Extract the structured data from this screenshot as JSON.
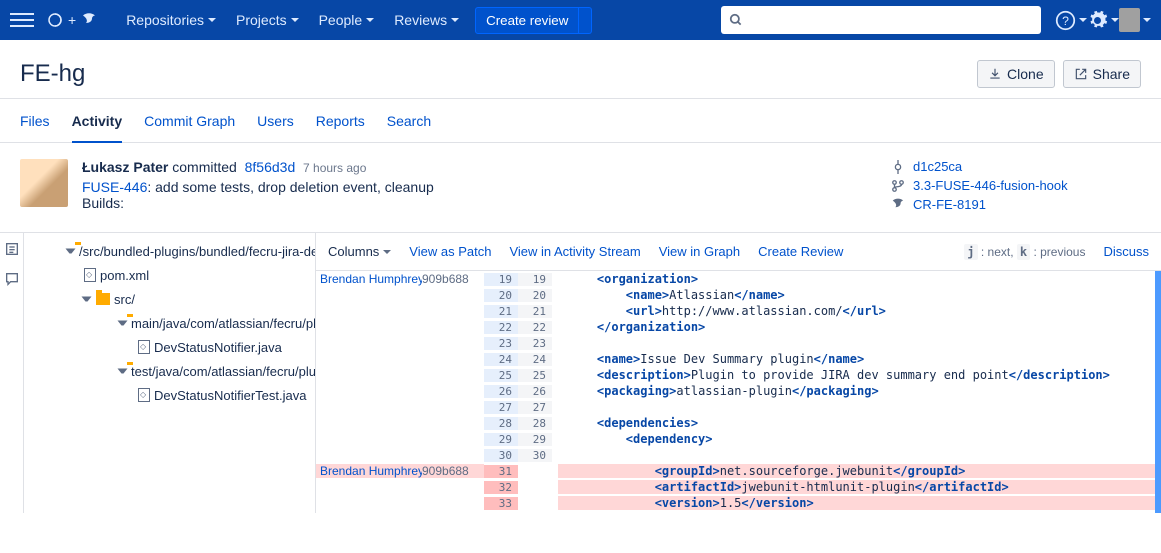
{
  "nav": {
    "items": [
      "Repositories",
      "Projects",
      "People",
      "Reviews"
    ],
    "create": "Create review",
    "search_placeholder": ""
  },
  "header": {
    "title": "FE-hg",
    "clone": "Clone",
    "share": "Share"
  },
  "tabs": [
    "Files",
    "Activity",
    "Commit Graph",
    "Users",
    "Reports",
    "Search"
  ],
  "active_tab": "Activity",
  "commit": {
    "author": "Łukasz Pater",
    "verb": "committed",
    "hash": "8f56d3d",
    "time": "7 hours ago",
    "issue": "FUSE-446",
    "issue_rest": ": add some tests, drop deletion event, cleanup",
    "builds": "Builds:",
    "meta": {
      "parent": "d1c25ca",
      "branch": "3.3-FUSE-446-fusion-hook",
      "review": "CR-FE-8191"
    }
  },
  "tree": {
    "root": "/src/bundled-plugins/bundled/fecru-jira-de",
    "pom": "pom.xml",
    "src": "src/",
    "main": "main/java/com/atlassian/fecru/plug",
    "f1": "DevStatusNotifier.java",
    "test": "test/java/com/atlassian/fecru/plugin",
    "f2": "DevStatusNotifierTest.java"
  },
  "difftb": {
    "columns": "Columns",
    "patch": "View as Patch",
    "stream": "View in Activity Stream",
    "graph": "View in Graph",
    "create": "Create Review",
    "hint_j": "j",
    "hint_next": " : next, ",
    "hint_k": "k",
    "hint_prev": " : previous",
    "discuss": "Discuss"
  },
  "diff": {
    "blame": "Brendan Humphreys",
    "bhash": "909b688",
    "lines": [
      {
        "a": 19,
        "b": 19,
        "html": "    <span class='tag'>&lt;organization&gt;</span>"
      },
      {
        "a": 20,
        "b": 20,
        "html": "        <span class='tag'>&lt;name&gt;</span>Atlassian<span class='tag'>&lt;/name&gt;</span>"
      },
      {
        "a": 21,
        "b": 21,
        "html": "        <span class='tag'>&lt;url&gt;</span>http://www.atlassian.com/<span class='tag'>&lt;/url&gt;</span>"
      },
      {
        "a": 22,
        "b": 22,
        "html": "    <span class='tag'>&lt;/organization&gt;</span>"
      },
      {
        "a": 23,
        "b": 23,
        "html": ""
      },
      {
        "a": 24,
        "b": 24,
        "html": "    <span class='tag'>&lt;name&gt;</span>Issue Dev Summary plugin<span class='tag'>&lt;/name&gt;</span>"
      },
      {
        "a": 25,
        "b": 25,
        "html": "    <span class='tag'>&lt;description&gt;</span>Plugin to provide JIRA dev summary end point<span class='tag'>&lt;/description&gt;</span>"
      },
      {
        "a": 26,
        "b": 26,
        "html": "    <span class='tag'>&lt;packaging&gt;</span>atlassian-plugin<span class='tag'>&lt;/packaging&gt;</span>"
      },
      {
        "a": 27,
        "b": 27,
        "html": ""
      },
      {
        "a": 28,
        "b": 28,
        "html": "    <span class='tag'>&lt;dependencies&gt;</span>"
      },
      {
        "a": 29,
        "b": 29,
        "html": "        <span class='tag'>&lt;dependency&gt;</span>"
      },
      {
        "a": 30,
        "b": 30,
        "html": ""
      }
    ],
    "del": [
      {
        "a": 31,
        "html": "            <span class='tag'>&lt;groupId&gt;</span>net.sourceforge.jwebunit<span class='tag'>&lt;/groupId&gt;</span>"
      },
      {
        "a": 32,
        "html": "            <span class='tag'>&lt;artifactId&gt;</span>jwebunit-htmlunit-plugin<span class='tag'>&lt;/artifactId&gt;</span>"
      },
      {
        "a": 33,
        "html": "            <span class='tag'>&lt;version&gt;</span>1.5<span class='tag'>&lt;/version&gt;</span>"
      }
    ]
  }
}
